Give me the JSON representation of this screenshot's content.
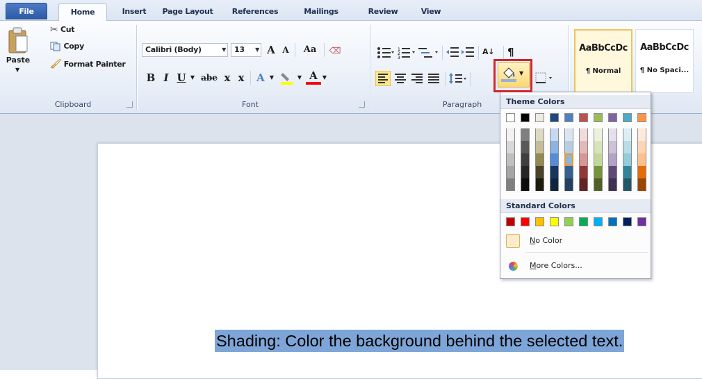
{
  "tabs": [
    "File",
    "Home",
    "Insert",
    "Page Layout",
    "References",
    "Mailings",
    "Review",
    "View"
  ],
  "clipboard": {
    "paste": "Paste",
    "cut": "Cut",
    "copy": "Copy",
    "format_painter": "Format Painter",
    "group_label": "Clipboard"
  },
  "font": {
    "name": "Calibri (Body)",
    "size": "13",
    "grow": "A",
    "shrink": "A",
    "change_case": "Aa",
    "bold": "B",
    "italic": "I",
    "underline": "U",
    "strike": "abe",
    "subscript": "x",
    "superscript": "x",
    "text_effect": "A",
    "font_color": "A",
    "group_label": "Font"
  },
  "paragraph": {
    "group_label": "Paragraph",
    "pilcrow": "¶",
    "sort": "A↓"
  },
  "styles": [
    {
      "sample": "AaBbCcDc",
      "name": "¶ Normal"
    },
    {
      "sample": "AaBbCcDc",
      "name": "¶ No Spaci..."
    }
  ],
  "palette": {
    "theme_header": "Theme Colors",
    "standard_header": "Standard Colors",
    "no_color": "No Color",
    "more_colors": "More Colors...",
    "theme_top": [
      "#ffffff",
      "#000000",
      "#eeece1",
      "#1f497d",
      "#4f81bd",
      "#c0504d",
      "#9bbb59",
      "#8064a2",
      "#4bacc6",
      "#f79646"
    ],
    "theme_shades": [
      [
        "#f2f2f2",
        "#7f7f7f",
        "#ddd9c3",
        "#c6d9f0",
        "#dbe5f1",
        "#f2dcdb",
        "#ebf1dd",
        "#e5e0ec",
        "#dbeef3",
        "#fdeada"
      ],
      [
        "#d8d8d8",
        "#595959",
        "#c4bd97",
        "#8db3e2",
        "#b8cce4",
        "#e5b9b7",
        "#d7e3bc",
        "#ccc1d9",
        "#b7dde8",
        "#fbd5b5"
      ],
      [
        "#bfbfbf",
        "#3f3f3f",
        "#938953",
        "#548dd4",
        "#95b3d7",
        "#d99694",
        "#c3d69b",
        "#b2a2c7",
        "#92cddc",
        "#fac08f"
      ],
      [
        "#a5a5a5",
        "#262626",
        "#494429",
        "#17365d",
        "#366092",
        "#953734",
        "#76923c",
        "#5f497a",
        "#31859b",
        "#e36c09"
      ],
      [
        "#7f7f7f",
        "#0c0c0c",
        "#1d1b10",
        "#0f243e",
        "#244061",
        "#632423",
        "#4f6128",
        "#3f3151",
        "#205867",
        "#974806"
      ]
    ],
    "standard": [
      "#c00000",
      "#ff0000",
      "#ffc000",
      "#ffff00",
      "#92d050",
      "#00b050",
      "#00b0f0",
      "#0070c0",
      "#002060",
      "#7030a0"
    ],
    "no_color_swatch": "#fdeccc",
    "selected_swatch": "#95b3d7"
  },
  "document": {
    "selected_text": "Shading: Color the background behind the selected text.",
    "highlight_color": "#7ea5d8"
  },
  "highlight": {
    "color": "#d0262d"
  }
}
